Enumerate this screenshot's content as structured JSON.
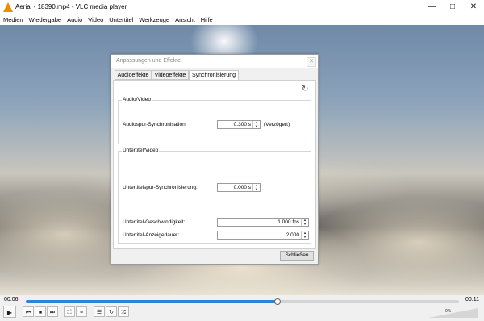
{
  "window": {
    "title": "Aerial - 18390.mp4 - VLC media player",
    "minimize_icon": "minimize-icon",
    "maximize_icon": "maximize-icon",
    "close_icon": "close-icon"
  },
  "menu": [
    "Medien",
    "Wiedergabe",
    "Audio",
    "Video",
    "Untertitel",
    "Werkzeuge",
    "Ansicht",
    "Hilfe"
  ],
  "player": {
    "elapsed": "00:06",
    "total": "00:11",
    "progress": 0.58,
    "volume_percent": "0%",
    "accent": "#2e82d6"
  },
  "dialog": {
    "title": "Anpassungen und Effekte",
    "tabs": [
      "Audioeffekte",
      "Videoeffekte",
      "Synchronisierung"
    ],
    "active_tab": "Synchronisierung",
    "audio_video": {
      "group_title": "Audio/Video",
      "label": "Audiospur-Synchronisation:",
      "value": "0.300 s",
      "note": "(Verzögert)"
    },
    "subtitle_video": {
      "group_title": "Untertitel/Video",
      "sync_label": "Untertitelspur-Synchronisierung:",
      "sync_value": "0.000 s",
      "speed_label": "Untertitel-Geschwindigkeit:",
      "speed_value": "1.000 fps",
      "duration_label": "Untertitel-Anzeigedauer:",
      "duration_value": "2.000"
    },
    "close_label": "Schließen"
  }
}
